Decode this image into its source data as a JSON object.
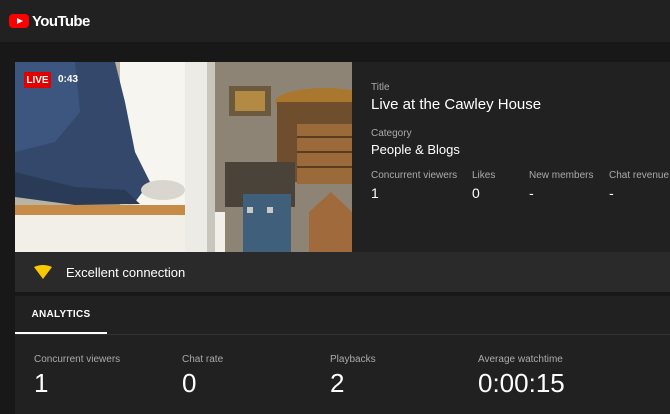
{
  "app": {
    "logo_text": "YouTube"
  },
  "stream": {
    "live_label": "LIVE",
    "elapsed": "0:43",
    "title_label": "Title",
    "title": "Live at the Cawley House",
    "category_label": "Category",
    "category": "People & Blogs",
    "stats": [
      {
        "label": "Concurrent viewers",
        "value": "1"
      },
      {
        "label": "Likes",
        "value": "0"
      },
      {
        "label": "New members",
        "value": "-"
      },
      {
        "label": "Chat revenue",
        "value": "-"
      }
    ]
  },
  "connection": {
    "icon": "wifi-icon",
    "status": "Excellent connection",
    "color": "#f9c900"
  },
  "analytics": {
    "tab_label": "ANALYTICS",
    "stats": [
      {
        "label": "Concurrent viewers",
        "value": "1"
      },
      {
        "label": "Chat rate",
        "value": "0"
      },
      {
        "label": "Playbacks",
        "value": "2"
      },
      {
        "label": "Average watchtime",
        "value": "0:00:15"
      }
    ]
  },
  "colors": {
    "live_badge": "#e00000",
    "brand": "#ff0000"
  }
}
